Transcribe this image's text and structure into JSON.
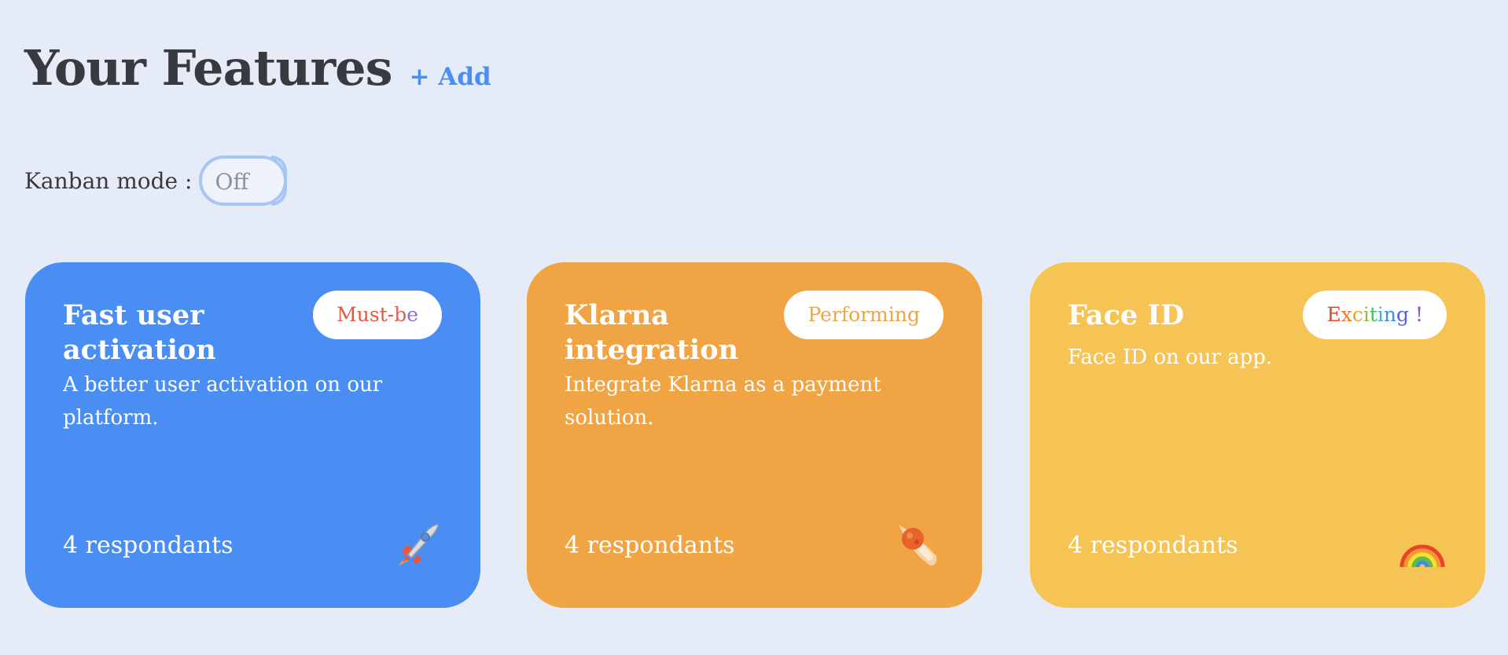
{
  "header": {
    "title": "Your Features",
    "add_label": "+ Add"
  },
  "kanban": {
    "label": "Kanban mode :",
    "toggle_state": "Off"
  },
  "cards": [
    {
      "title": "Fast user activation",
      "description": "A better user activation on our platform.",
      "badge": "Must-be",
      "respondents": "4 respondants",
      "icon": "rocket-icon",
      "background": "#4a8ef3"
    },
    {
      "title": "Klarna integration",
      "description": "Integrate Klarna as a payment solution.",
      "badge": "Performing",
      "respondents": "4 respondants",
      "icon": "comet-icon",
      "background": "#f0a444"
    },
    {
      "title": "Face ID",
      "description": "Face ID on our app.",
      "badge": "Exciting !",
      "respondents": "4 respondants",
      "icon": "rainbow-icon",
      "background": "#f5c455"
    }
  ],
  "colors": {
    "background": "#e5ecf7",
    "accent": "#4a8ef3",
    "text": "#383a40",
    "badge_must_be": "#e8553f",
    "badge_performing": "#f0a444"
  }
}
